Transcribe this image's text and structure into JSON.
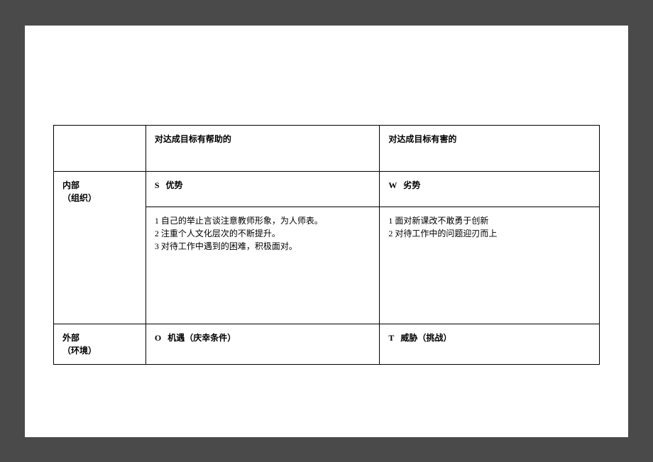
{
  "table": {
    "header": {
      "helpful": "对达成目标有帮助的",
      "harmful": "对达成目标有害的"
    },
    "internal": {
      "label": "内部",
      "sublabel": "（组织）",
      "strengths_code": "S",
      "strengths_label": "优势",
      "weaknesses_code": "W",
      "weaknesses_label": "劣势",
      "strengths_content": "1 自己的举止言谈注意教师形象，为人师表。\n2 注重个人文化层次的不断提升。\n3 对待工作中遇到的困难，积极面对。",
      "weaknesses_content": "1 面对新课改不敢勇于创新\n2 对待工作中的问题迎刃而上"
    },
    "external": {
      "label": "外部",
      "sublabel": "（环境）",
      "opportunities_code": "O",
      "opportunities_label": "机遇（庆幸条件）",
      "threats_code": "T",
      "threats_label": "威胁（挑战）"
    }
  }
}
